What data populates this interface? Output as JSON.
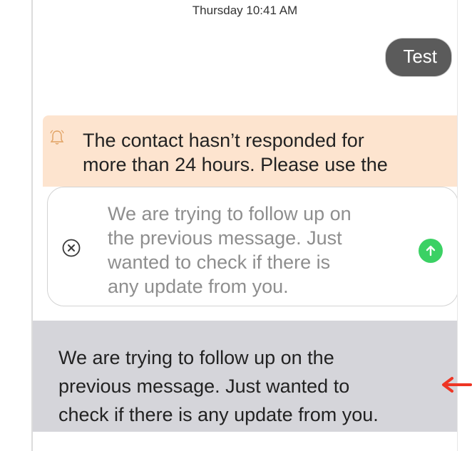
{
  "conversation": {
    "timestamp": "Thursday 10:41 AM",
    "sent_message": "Test"
  },
  "warning": {
    "icon": "bell-icon",
    "text_line1": "The contact hasn’t responded for",
    "text_line2": "more than 24 hours. Please use the"
  },
  "composer": {
    "clear_icon": "close-circle-icon",
    "line1": "We are trying to follow up on",
    "line2": "the previous message. Just",
    "line3": "wanted to check if there is",
    "line4": "any update from you.",
    "send_icon": "arrow-up-icon",
    "send_color": "#3bd164"
  },
  "suggestion": {
    "line1": "We are trying to follow up on the",
    "line2": "previous message. Just wanted to",
    "line3": "check if there is any update from you."
  },
  "annotation": {
    "arrow_icon": "red-arrow-left-icon",
    "arrow_color": "#ee3524"
  }
}
